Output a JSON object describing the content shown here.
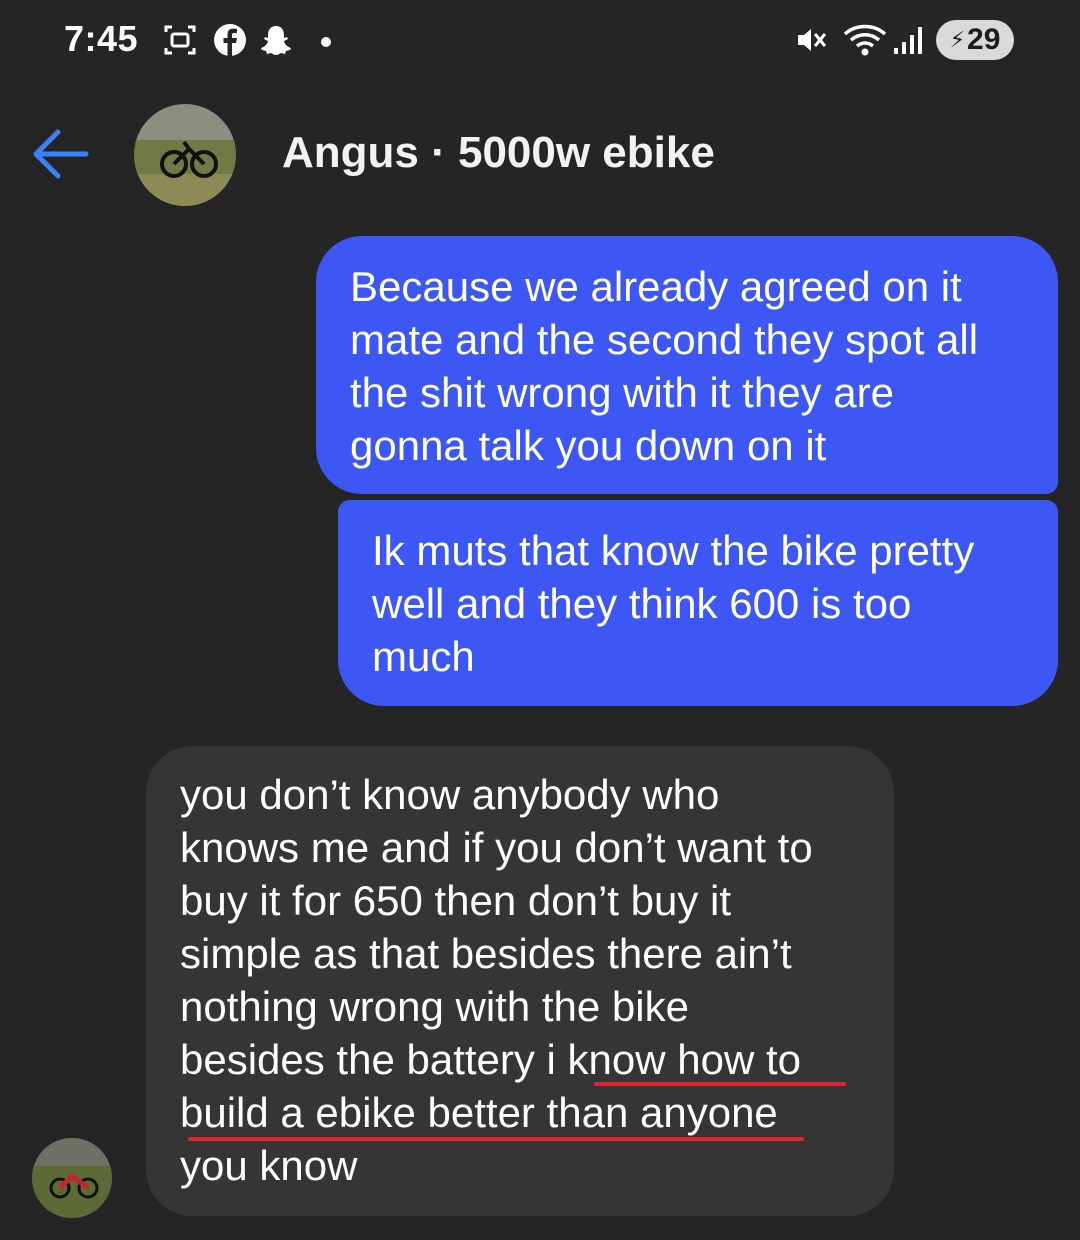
{
  "status_bar": {
    "time": "7:45",
    "battery_level": "29",
    "icons": [
      "screenshot-icon",
      "facebook-icon",
      "snapchat-icon",
      "dot-icon",
      "mute-icon",
      "wifi-icon",
      "signal-icon",
      "battery-charging-icon"
    ]
  },
  "header": {
    "title": "Angus · 5000w ebike",
    "back_icon": "arrow-left-icon"
  },
  "messages": [
    {
      "direction": "outgoing",
      "text": "Because we already agreed on it\nmate and the second they spot all\nthe shit wrong with it they are\ngonna talk you down on it"
    },
    {
      "direction": "outgoing",
      "text": "Ik muts that know the bike pretty\nwell and they think 600 is too\nmuch"
    },
    {
      "direction": "incoming",
      "text": "you don’t know anybody who\nknows me and if you don’t want to\nbuy it for 650 then don’t buy it\nsimple as that besides there ain’t\nnothing wrong with the bike\nbesides the battery i know how to\nbuild a ebike better than anyone\nyou know",
      "underlined_text": "know how to build a ebike better than anyone"
    }
  ],
  "colors": {
    "background": "#252526",
    "outgoing_bubble": "#3d57f5",
    "incoming_bubble": "#353535",
    "accent_back": "#3b82f6",
    "underline": "#e0222b"
  }
}
